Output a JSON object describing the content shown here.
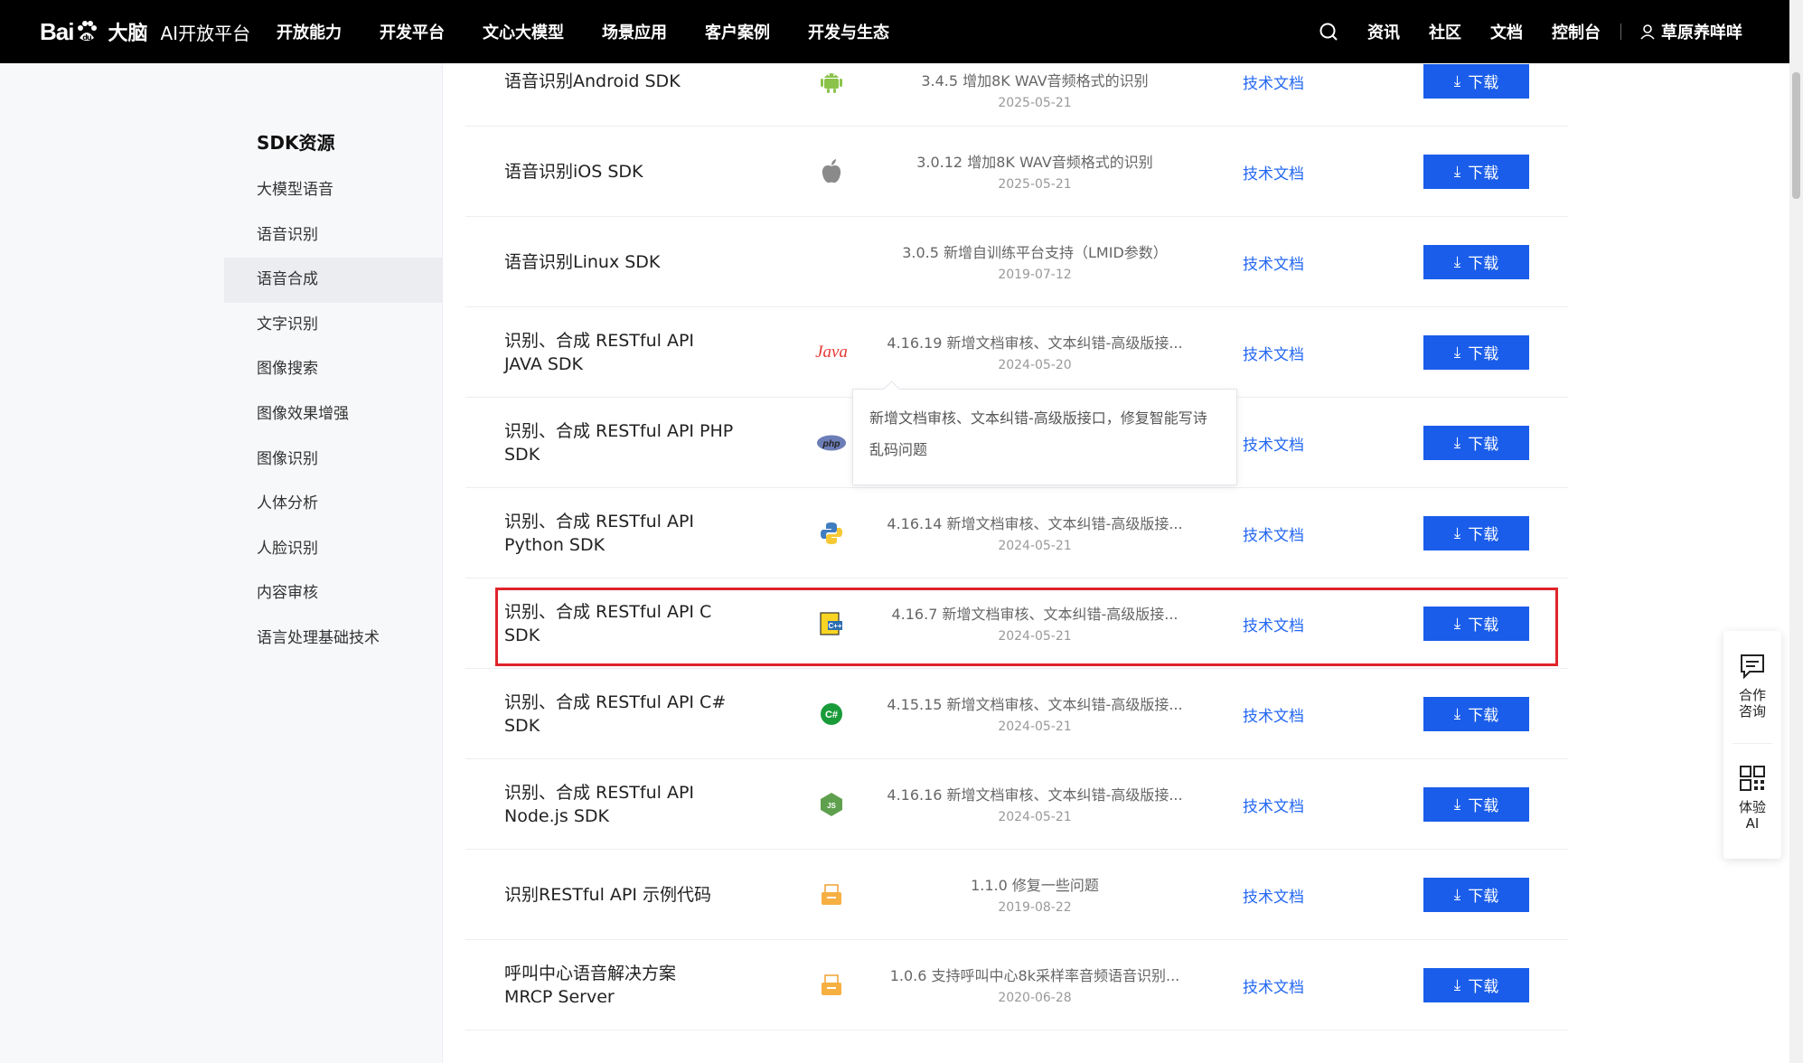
{
  "nav": {
    "logo_text": "Bai",
    "logo_du": "du",
    "brand": "大脑",
    "platform": "AI开放平台",
    "links": [
      "开放能力",
      "开发平台",
      "文心大模型",
      "场景应用",
      "客户案例",
      "开发与生态"
    ],
    "right_links": [
      "资讯",
      "社区",
      "文档",
      "控制台"
    ],
    "username": "草原养咩咩"
  },
  "sidebar": {
    "title": "SDK资源",
    "items": [
      "大模型语音",
      "语音识别",
      "语音合成",
      "文字识别",
      "图像搜索",
      "图像效果增强",
      "图像识别",
      "人体分析",
      "人脸识别",
      "内容审核",
      "语言处理基础技术"
    ],
    "active_index": 2
  },
  "rows": [
    {
      "name_l1": "语音识别Android SDK",
      "name_l2": "",
      "icon": "android-icon",
      "version": "3.4.5 增加8K WAV音频格式的识别",
      "date": "2025-05-21",
      "doc": "技术文档",
      "download": "下载"
    },
    {
      "name_l1": "语音识别iOS SDK",
      "name_l2": "",
      "icon": "apple-icon",
      "version": "3.0.12 增加8K WAV音频格式的识别",
      "date": "2025-05-21",
      "doc": "技术文档",
      "download": "下载"
    },
    {
      "name_l1": "语音识别Linux SDK",
      "name_l2": "",
      "icon": "linux-icon",
      "version": "3.0.5 新增自训练平台支持（LMID参数）",
      "date": "2019-07-12",
      "doc": "技术文档",
      "download": "下载"
    },
    {
      "name_l1": "识别、合成 RESTful API",
      "name_l2": "JAVA SDK",
      "icon": "java-icon",
      "version": "4.16.19 新增文档审核、文本纠错-高级版接...",
      "date": "2024-05-20",
      "doc": "技术文档",
      "download": "下载"
    },
    {
      "name_l1": "识别、合成 RESTful API PHP",
      "name_l2": "SDK",
      "icon": "php-icon",
      "version": "",
      "date": "",
      "doc": "技术文档",
      "download": "下载"
    },
    {
      "name_l1": "识别、合成 RESTful API",
      "name_l2": "Python SDK",
      "icon": "python-icon",
      "version": "4.16.14 新增文档审核、文本纠错-高级版接...",
      "date": "2024-05-21",
      "doc": "技术文档",
      "download": "下载"
    },
    {
      "name_l1": "识别、合成 RESTful API C",
      "name_l2": "SDK",
      "icon": "c-icon",
      "version": "4.16.7 新增文档审核、文本纠错-高级版接...",
      "date": "2024-05-21",
      "doc": "技术文档",
      "download": "下载"
    },
    {
      "name_l1": "识别、合成 RESTful API C#",
      "name_l2": "SDK",
      "icon": "csharp-icon",
      "version": "4.15.15 新增文档审核、文本纠错-高级版接...",
      "date": "2024-05-21",
      "doc": "技术文档",
      "download": "下载"
    },
    {
      "name_l1": "识别、合成 RESTful API",
      "name_l2": "Node.js SDK",
      "icon": "nodejs-icon",
      "version": "4.16.16 新增文档审核、文本纠错-高级版接...",
      "date": "2024-05-21",
      "doc": "技术文档",
      "download": "下载"
    },
    {
      "name_l1": "识别RESTful API 示例代码",
      "name_l2": "",
      "icon": "code-sample-icon",
      "version": "1.1.0 修复一些问题",
      "date": "2019-08-22",
      "doc": "技术文档",
      "download": "下载"
    },
    {
      "name_l1": "呼叫中心语音解决方案",
      "name_l2": "MRCP Server",
      "icon": "mrcp-icon",
      "version": "1.0.6 支持呼叫中心8k采样率音频语音识别...",
      "date": "2020-06-28",
      "doc": "技术文档",
      "download": "下载"
    }
  ],
  "tooltip": {
    "line1": "新增文档审核、文本纠错-高级版接口，修复智能写诗",
    "line2": "乱码问题"
  },
  "float_panel": {
    "consult_l1": "合作",
    "consult_l2": "咨询",
    "try_l1": "体验",
    "try_l2": "AI"
  },
  "colors": {
    "nav_bg": "#000000",
    "accent": "#1a5dea",
    "link": "#2468f2",
    "highlight": "#e0242a"
  }
}
